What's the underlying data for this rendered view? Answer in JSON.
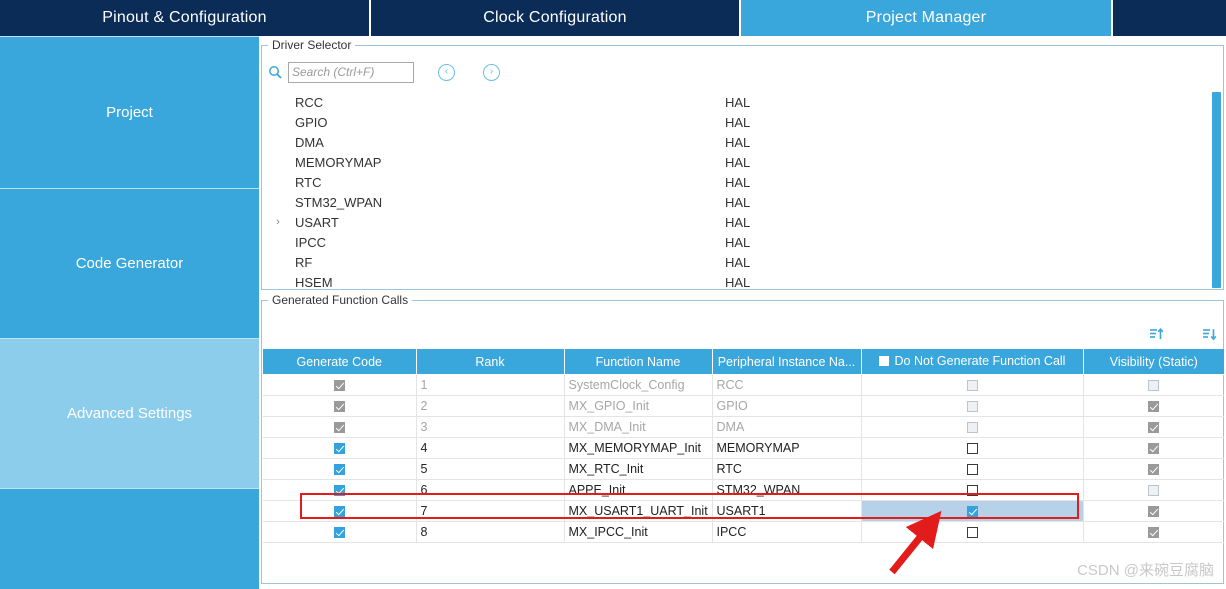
{
  "tabs": [
    {
      "label": "Pinout & Configuration",
      "active": false
    },
    {
      "label": "Clock Configuration",
      "active": false
    },
    {
      "label": "Project Manager",
      "active": true
    }
  ],
  "sidebar": {
    "items": [
      {
        "label": "Project"
      },
      {
        "label": "Code Generator"
      },
      {
        "label": "Advanced Settings"
      },
      {
        "label": ""
      }
    ]
  },
  "driver_selector": {
    "legend": "Driver Selector",
    "search": {
      "placeholder": "Search (Ctrl+F)",
      "value": ""
    },
    "nav_prev_icon": "‹",
    "nav_next_icon": "›",
    "expander_icon": "›",
    "rows": [
      {
        "name": "RCC",
        "value": "HAL",
        "expandable": false
      },
      {
        "name": "GPIO",
        "value": "HAL",
        "expandable": false
      },
      {
        "name": "DMA",
        "value": "HAL",
        "expandable": false
      },
      {
        "name": "MEMORYMAP",
        "value": "HAL",
        "expandable": false
      },
      {
        "name": "RTC",
        "value": "HAL",
        "expandable": false
      },
      {
        "name": "STM32_WPAN",
        "value": "HAL",
        "expandable": false
      },
      {
        "name": "USART",
        "value": "HAL",
        "expandable": true
      },
      {
        "name": "IPCC",
        "value": "HAL",
        "expandable": false
      },
      {
        "name": "RF",
        "value": "HAL",
        "expandable": false
      },
      {
        "name": "HSEM",
        "value": "HAL",
        "expandable": false
      }
    ]
  },
  "generated_function_calls": {
    "legend": "Generated Function Calls",
    "sort_ascending_title": "Sort ascending",
    "sort_descending_title": "Sort descending",
    "columns": [
      "Generate Code",
      "Rank",
      "Function Name",
      "Peripheral Instance Na...",
      "Do Not Generate Function Call",
      "Visibility (Static)"
    ],
    "header_do_not_generate_checked": false,
    "rows": [
      {
        "generate_code": "checked-disabled",
        "rank": "1",
        "function_name": "SystemClock_Config",
        "peripheral": "RCC",
        "do_not_generate": "unchecked-disabled",
        "visibility": "unchecked-disabled",
        "dim": true,
        "highlighted": false
      },
      {
        "generate_code": "checked-disabled",
        "rank": "2",
        "function_name": "MX_GPIO_Init",
        "peripheral": "GPIO",
        "do_not_generate": "unchecked-disabled",
        "visibility": "checked-disabled",
        "dim": true,
        "highlighted": false
      },
      {
        "generate_code": "checked-disabled",
        "rank": "3",
        "function_name": "MX_DMA_Init",
        "peripheral": "DMA",
        "do_not_generate": "unchecked-disabled",
        "visibility": "checked-disabled",
        "dim": true,
        "highlighted": false
      },
      {
        "generate_code": "checked",
        "rank": "4",
        "function_name": "MX_MEMORYMAP_Init",
        "peripheral": "MEMORYMAP",
        "do_not_generate": "unchecked",
        "visibility": "checked-disabled",
        "dim": false,
        "highlighted": false
      },
      {
        "generate_code": "checked",
        "rank": "5",
        "function_name": "MX_RTC_Init",
        "peripheral": "RTC",
        "do_not_generate": "unchecked",
        "visibility": "checked-disabled",
        "dim": false,
        "highlighted": false
      },
      {
        "generate_code": "checked",
        "rank": "6",
        "function_name": "APPE_Init",
        "peripheral": "STM32_WPAN",
        "do_not_generate": "unchecked",
        "visibility": "unchecked-disabled",
        "dim": false,
        "highlighted": false
      },
      {
        "generate_code": "checked",
        "rank": "7",
        "function_name": "MX_USART1_UART_Init",
        "peripheral": "USART1",
        "do_not_generate": "checked",
        "visibility": "checked-disabled",
        "dim": false,
        "highlighted": true
      },
      {
        "generate_code": "checked",
        "rank": "8",
        "function_name": "MX_IPCC_Init",
        "peripheral": "IPCC",
        "do_not_generate": "unchecked",
        "visibility": "checked-disabled",
        "dim": false,
        "highlighted": false
      }
    ]
  },
  "annotations": {
    "highlight_color": "#e21b1b",
    "arrow_color": "#e21b1b"
  },
  "watermark": {
    "text": "CSDN @来碗豆腐脑"
  },
  "colors": {
    "tab_inactive_bg": "#0a2c56",
    "tab_active_bg": "#3aa7dc",
    "sidebar_bg": "#3aa7dc",
    "sidebar_active_bg": "#8bcdeb",
    "table_header_bg": "#3aa7dc",
    "row_highlight_bg": "#b7d1e8"
  }
}
